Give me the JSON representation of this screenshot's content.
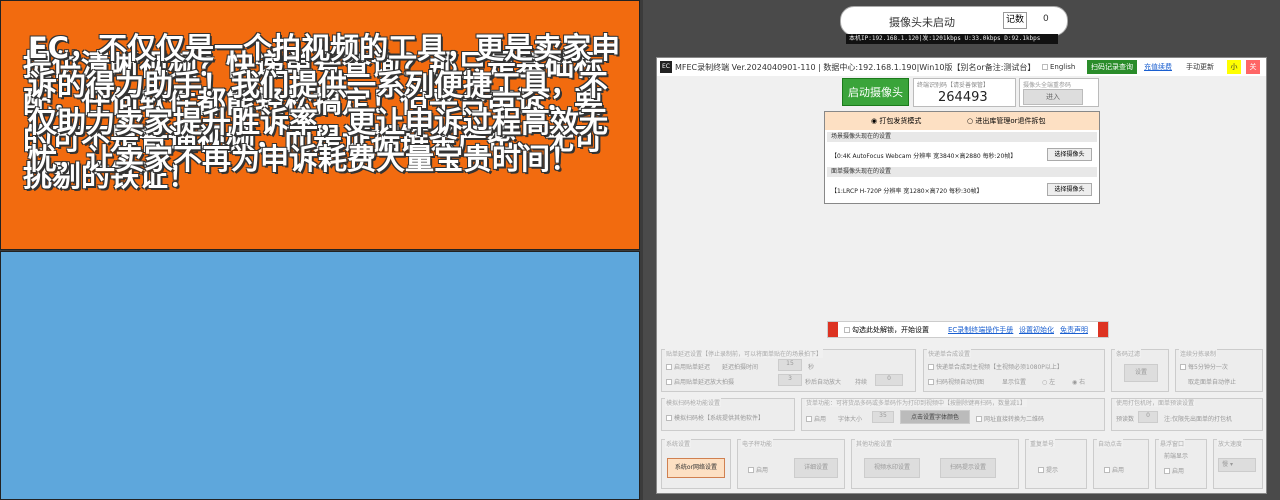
{
  "promo": {
    "orange_text": "提供清晰视频？快递单号查询？那只是基础标配，任何软件都能轻松搞定！但平台申诉，要的可不是普通视频，而是证据链条严密、无可挑剔的铁证！",
    "blue_text": "EC，不仅仅是一个拍视频的工具，更是卖家申诉的得力助手！我们提供一系列便捷工具，不仅助力卖家提升胜诉率，更让申诉过程高效无忧，让卖家不再为申诉耗费大量宝贵时间！"
  },
  "topbar": {
    "status": "摄像头未启动",
    "count_label": "记数",
    "count_value": "0",
    "net": "本机IP:192.168.1.120|发:1201kbps  U:33.0kbps  D:92.1kbps"
  },
  "window": {
    "title": "MFEC录制终端 Ver.2024040901-110 | 数据中心:192.168.1.190|Win10版【别名or备注:测试台】",
    "english_label": "English",
    "scan_record": "扫码记录查询",
    "recharge": "充值续费",
    "manual_update": "手动更新",
    "min": "小",
    "close": "关"
  },
  "start_button": "启动摄像头",
  "code": {
    "label": "终端识别码【请妥善保管】",
    "value": "264493"
  },
  "cam_ref": {
    "label": "摄像头全端重参码",
    "button": "进入"
  },
  "modes": {
    "ship": "打包发货模式",
    "return": "进出库管理or退件拆包"
  },
  "scene_cam": {
    "header": "场景摄像头现在的设置",
    "value": "【0:4K AutoFocus Webcam  分辨率 宽3840×高2880 每秒:20帧】",
    "button": "选择摄像头"
  },
  "face_cam": {
    "header": "面单摄像头现在的设置",
    "value": "【1:LRCP H-720P  分辨率 宽1280×高720 每秒:30帧】",
    "button": "选择摄像头"
  },
  "agree": {
    "text": "勾选此处解锁，开始设置",
    "manual": "EC录制终端操作手册",
    "init": "设置初始化",
    "disclaimer": "免责声明"
  },
  "settings": {
    "paste_title": "贴单延迟设置【停止录制前，可以将面单贴在的场景拍下】",
    "paste_enable": "启用贴单延迟",
    "paste_delay": "延迟拍摄时间",
    "paste_delay_val": "15",
    "sec": "秒",
    "paste_zoom": "启用贴单延迟放大拍摄",
    "paste_zoom_val": "3",
    "zoom_sec": "秒后自动放大",
    "wait": "持续",
    "wait_val": "0",
    "fast_title": "快递单合成设置",
    "fast1": "快递单合成到主视频【主视频必须1080P以上】",
    "fast2": "扫码视频自动切图",
    "pos": "显示位置",
    "left": "左",
    "right": "右",
    "barcode_title": "条码过滤",
    "barcode_btn": "设置",
    "cont_title": "连续分拣录制",
    "cont1": "每5分钟分一次",
    "cont2": "取走面单自动停止",
    "simulate_title": "模拟扫码枪功能设置",
    "simulate": "模拟扫码枪【系统提供其他软件】",
    "goods_title": "货单功能：可将货品多码或多单码作为打印到视频中【按删除键再扫码，数量减1】",
    "goods_enable": "启用",
    "font_size": "字体大小",
    "font_size_val": "35",
    "font_color": "点击设置字体颜色",
    "qr": "网址直接转换为二维码",
    "pretime_title": "使用打包机时，面单预读设置",
    "pretime": "预读数",
    "pretime_val": "0",
    "pretime_note": "注:仅限先出面单的打包机",
    "sys_title": "系统设置",
    "sys_btn": "系统or网络设置",
    "scale_title": "电子秤功能",
    "scale_enable": "启用",
    "scale_btn": "详细设置",
    "other_title": "其他功能设置",
    "watermark": "视频水印设置",
    "scan_tip": "扫码提示设置",
    "dup_title": "重复单号",
    "dup": "提示",
    "auto_title": "自动点击",
    "auto": "启用",
    "float_title": "悬浮窗口",
    "float_sub": "前端显示",
    "float": "启用",
    "speed_title": "放大速度",
    "speed": "慢"
  }
}
